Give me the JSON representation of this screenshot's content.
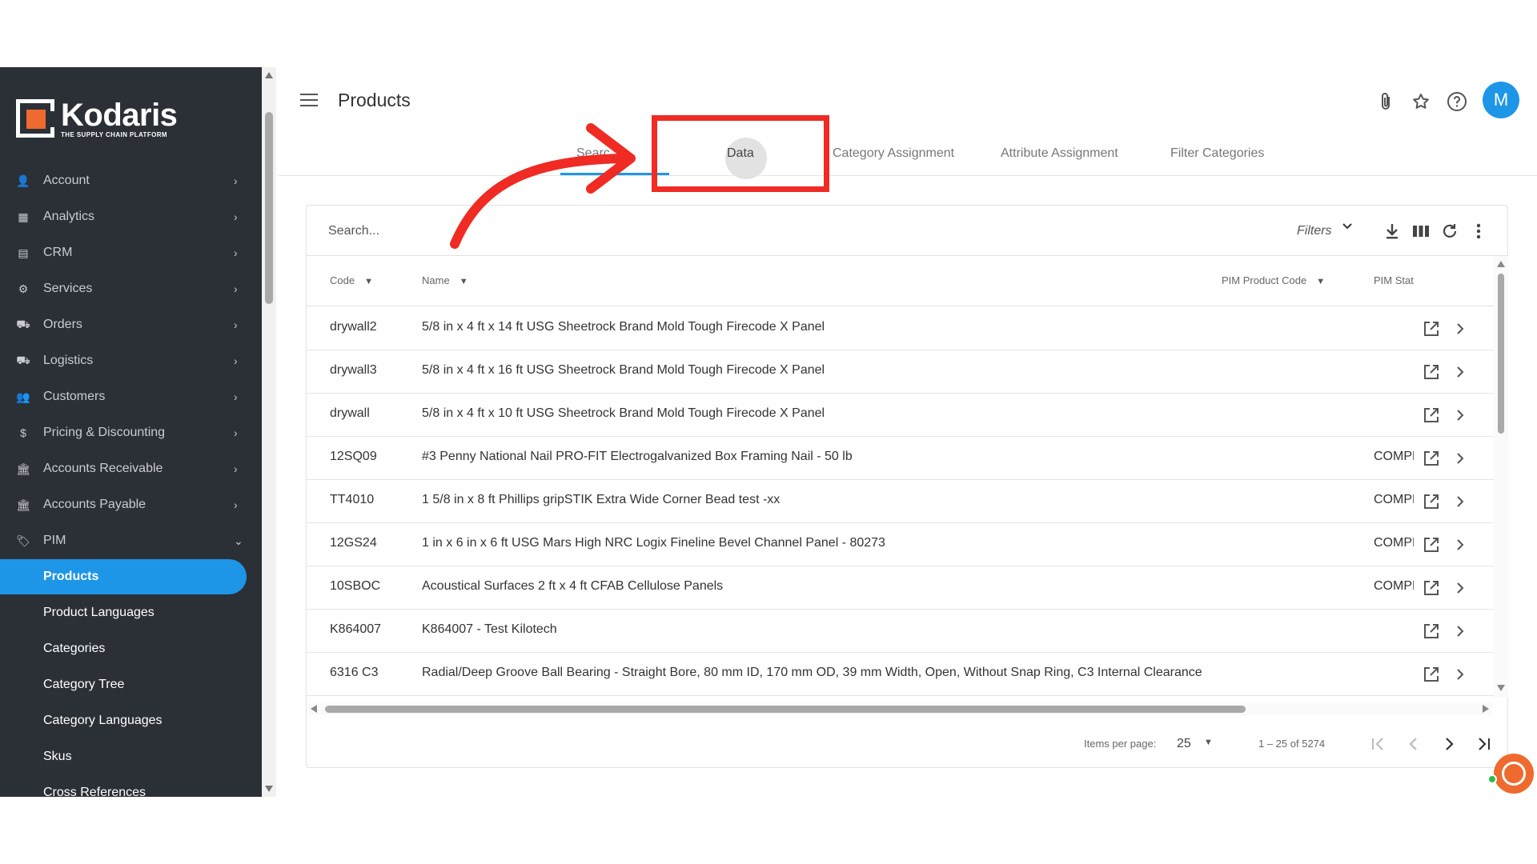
{
  "brand": {
    "name": "Kodaris",
    "tagline": "THE SUPPLY CHAIN PLATFORM",
    "accent": "#ee6a2f",
    "primary": "#1e96e8"
  },
  "header": {
    "title": "Products",
    "avatar_letter": "M"
  },
  "sidebar": {
    "items": [
      {
        "label": "Account",
        "icon": "person-icon",
        "glyph": "👤"
      },
      {
        "label": "Analytics",
        "icon": "analytics-icon",
        "glyph": "▦"
      },
      {
        "label": "CRM",
        "icon": "contact-card-icon",
        "glyph": "▤"
      },
      {
        "label": "Services",
        "icon": "gears-icon",
        "glyph": "⚙"
      },
      {
        "label": "Orders",
        "icon": "truck-icon",
        "glyph": "⛟"
      },
      {
        "label": "Logistics",
        "icon": "shipping-icon",
        "glyph": "⛟"
      },
      {
        "label": "Customers",
        "icon": "people-icon",
        "glyph": "👥"
      },
      {
        "label": "Pricing & Discounting",
        "icon": "dollar-icon",
        "glyph": "$"
      },
      {
        "label": "Accounts Receivable",
        "icon": "bank-icon",
        "glyph": "🏛"
      },
      {
        "label": "Accounts Payable",
        "icon": "bank-icon",
        "glyph": "🏛"
      },
      {
        "label": "PIM",
        "icon": "tag-icon",
        "glyph": "🏷"
      }
    ],
    "pim_children": [
      "Products",
      "Product Languages",
      "Categories",
      "Category Tree",
      "Category Languages",
      "Skus",
      "Cross References"
    ]
  },
  "tabs": [
    "Search",
    "Data",
    "Category Assignment",
    "Attribute Assignment",
    "Filter Categories"
  ],
  "tabs_visible_search_text": "Searc",
  "toolbar": {
    "search_placeholder": "Search...",
    "filters_label": "Filters"
  },
  "table": {
    "columns": [
      "Code",
      "Name",
      "PIM Product Code",
      "PIM Stat"
    ],
    "rows": [
      {
        "code": "drywall2",
        "name": "5/8 in x 4 ft x 14 ft USG Sheetrock Brand Mold Tough Firecode X Panel",
        "pim_status": ""
      },
      {
        "code": "drywall3",
        "name": "5/8 in x 4 ft x 16 ft USG Sheetrock Brand Mold Tough Firecode X Panel",
        "pim_status": ""
      },
      {
        "code": "drywall",
        "name": "5/8 in x 4 ft x 10 ft USG Sheetrock Brand Mold Tough Firecode X Panel",
        "pim_status": ""
      },
      {
        "code": "12SQ09",
        "name": "#3 Penny National Nail PRO-FIT Electrogalvanized Box Framing Nail - 50 lb",
        "pim_status": "COMPL"
      },
      {
        "code": "TT4010",
        "name": "1 5/8 in x 8 ft Phillips gripSTIK Extra Wide Corner Bead test -xx",
        "pim_status": "COMPL"
      },
      {
        "code": "12GS24",
        "name": "1 in x 6 in x 6 ft USG Mars High NRC Logix Fineline Bevel Channel Panel - 80273",
        "pim_status": "COMPL"
      },
      {
        "code": "10SBOC",
        "name": "Acoustical Surfaces 2 ft x 4 ft CFAB Cellulose Panels",
        "pim_status": "COMPL"
      },
      {
        "code": "K864007",
        "name": "K864007 - Test Kilotech",
        "pim_status": ""
      },
      {
        "code": "6316 C3",
        "name": "Radial/Deep Groove Ball Bearing - Straight Bore, 80 mm ID, 170 mm OD, 39 mm Width, Open, Without Snap Ring, C3 Internal Clearance",
        "pim_status": ""
      }
    ]
  },
  "paginator": {
    "items_per_page_label": "Items per page:",
    "items_per_page": "25",
    "range_label": "1 – 25 of 5274"
  }
}
